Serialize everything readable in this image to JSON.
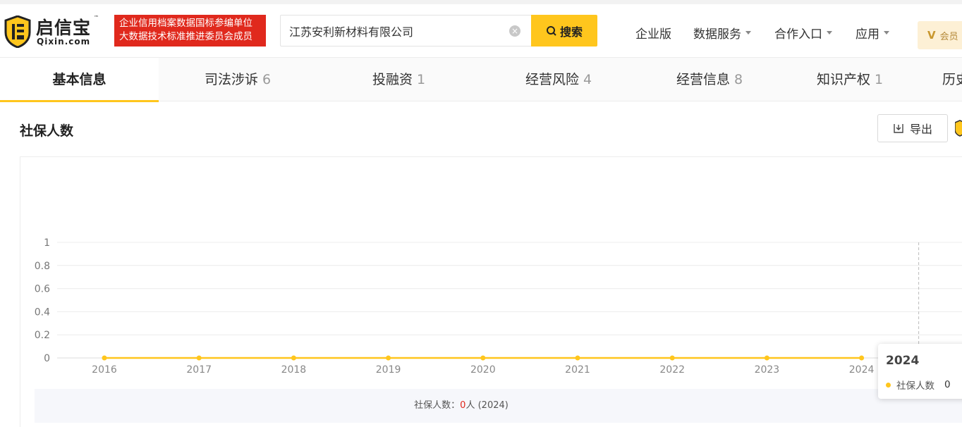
{
  "header": {
    "logo_text": "启信宝",
    "logo_tm": "™",
    "logo_sub": "Qixin.com",
    "badge_line1": "企业信用档案数据国标参编单位",
    "badge_line2": "大数据技术标准推进委员会成员",
    "search_value": "江苏安利新材料有限公司",
    "search_button": "搜索",
    "nav": {
      "enterprise": "企业版",
      "data_service": "数据服务",
      "cooperation": "合作入口",
      "apps": "应用"
    },
    "vip_label": "会员"
  },
  "tabs": [
    {
      "label": "基本信息",
      "count": ""
    },
    {
      "label": "司法涉诉",
      "count": "6"
    },
    {
      "label": "投融资",
      "count": "1"
    },
    {
      "label": "经营风险",
      "count": "4"
    },
    {
      "label": "经营信息",
      "count": "8"
    },
    {
      "label": "知识产权",
      "count": "1"
    },
    {
      "label": "历史",
      "count": ""
    }
  ],
  "section": {
    "title": "社保人数",
    "export_label": "导出"
  },
  "summary": {
    "prefix": "社保人数：",
    "value": "0",
    "unit": "人",
    "year": " (2024)"
  },
  "tooltip": {
    "title": "2024",
    "series_label": "社保人数",
    "value": "0"
  },
  "colors": {
    "accent": "#ffc61d",
    "brand_red": "#e0291d"
  },
  "chart_data": {
    "type": "line",
    "x": [
      "2016",
      "2017",
      "2018",
      "2019",
      "2020",
      "2021",
      "2022",
      "2023",
      "2024"
    ],
    "series": [
      {
        "name": "社保人数",
        "values": [
          0,
          0,
          0,
          0,
          0,
          0,
          0,
          0,
          0
        ]
      }
    ],
    "y_ticks": [
      "0",
      "0.2",
      "0.4",
      "0.6",
      "0.8",
      "1"
    ],
    "ylim": [
      0,
      1
    ],
    "grid": true,
    "highlight": "2024"
  }
}
